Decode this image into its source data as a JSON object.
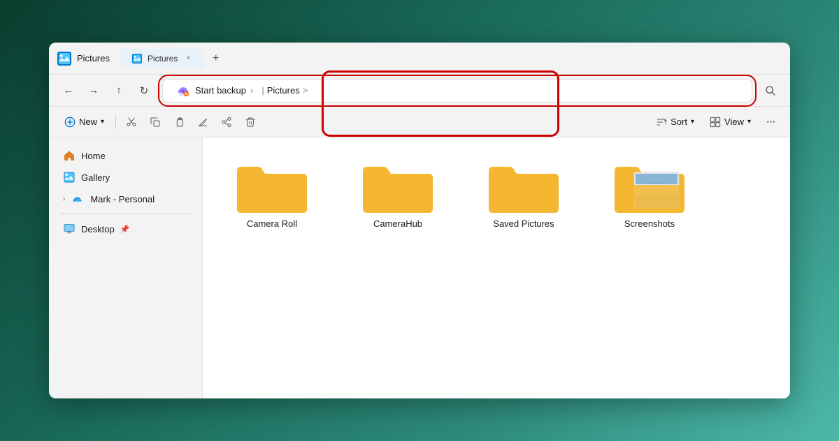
{
  "window": {
    "title": "Pictures",
    "tab_label": "Pictures",
    "tab_close": "×"
  },
  "nav": {
    "back": "←",
    "forward": "→",
    "up": "↑",
    "refresh": "↻"
  },
  "breadcrumb": {
    "backup_label": "Start backup",
    "separator": ">",
    "path_item": "Pictures",
    "path_separator": ">"
  },
  "command_bar": {
    "new_label": "New",
    "new_arrow": "˅",
    "cut_icon": "✂",
    "copy_icon": "⎘",
    "paste_icon": "📋",
    "rename_icon": "✏",
    "share_icon": "⤴",
    "delete_icon": "🗑",
    "sort_label": "Sort",
    "sort_arrow": "˅",
    "view_label": "View",
    "view_arrow": "˅",
    "more_icon": "···"
  },
  "sidebar": {
    "items": [
      {
        "label": "Home",
        "icon": "home",
        "hasArrow": false
      },
      {
        "label": "Gallery",
        "icon": "gallery",
        "hasArrow": false
      },
      {
        "label": "Mark - Personal",
        "icon": "cloud",
        "hasArrow": true
      }
    ],
    "divider": true,
    "pinned_items": [
      {
        "label": "Desktop",
        "icon": "desktop",
        "pinned": true
      }
    ]
  },
  "files": [
    {
      "name": "Camera Roll",
      "type": "folder",
      "hasContent": false
    },
    {
      "name": "CameraHub",
      "type": "folder",
      "hasContent": false
    },
    {
      "name": "Saved Pictures",
      "type": "folder",
      "hasContent": false
    },
    {
      "name": "Screenshots",
      "type": "folder",
      "hasContent": true
    }
  ],
  "colors": {
    "accent": "#0078d4",
    "folder_yellow": "#f5b731",
    "highlight_red": "#cc0000"
  }
}
